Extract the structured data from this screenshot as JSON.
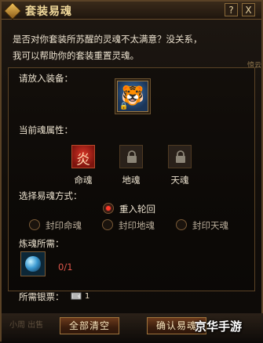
{
  "window": {
    "title": "套装易魂",
    "help_label": "?",
    "close_label": "X"
  },
  "intro": {
    "line1": "是否对你套装所苏醒的灵魂不太满意？没关系，",
    "line2": "我可以帮助你的套装重置灵魂。"
  },
  "side_tag": "惊云",
  "equip": {
    "label": "请放入装备：",
    "slot_icon": "white-tiger-armor-icon",
    "lock_glyph": "🔒"
  },
  "current_soul": {
    "label": "当前魂属性：",
    "items": [
      {
        "name": "命魂",
        "icon": "fire-soul-icon",
        "symbol": "炎",
        "locked": false
      },
      {
        "name": "地魂",
        "icon": "lock-icon",
        "locked": true
      },
      {
        "name": "天魂",
        "icon": "lock-icon",
        "locked": true
      }
    ]
  },
  "method": {
    "label": "选择易魂方式：",
    "options": [
      {
        "label": "重入轮回",
        "selected": true
      },
      {
        "label": "封印命魂",
        "selected": false
      },
      {
        "label": "封印地魂",
        "selected": false
      },
      {
        "label": "封印天魂",
        "selected": false
      }
    ]
  },
  "material": {
    "label": "炼魂所需：",
    "icon": "soul-orb-icon",
    "count": "0/1"
  },
  "cost": {
    "label": "所需银票：",
    "icon": "silver-note-icon",
    "value": "1"
  },
  "footer": {
    "faint_text": "小周 出售",
    "clear_all": "全部清空",
    "confirm": "确认易魂"
  },
  "watermark": "京华手游"
}
